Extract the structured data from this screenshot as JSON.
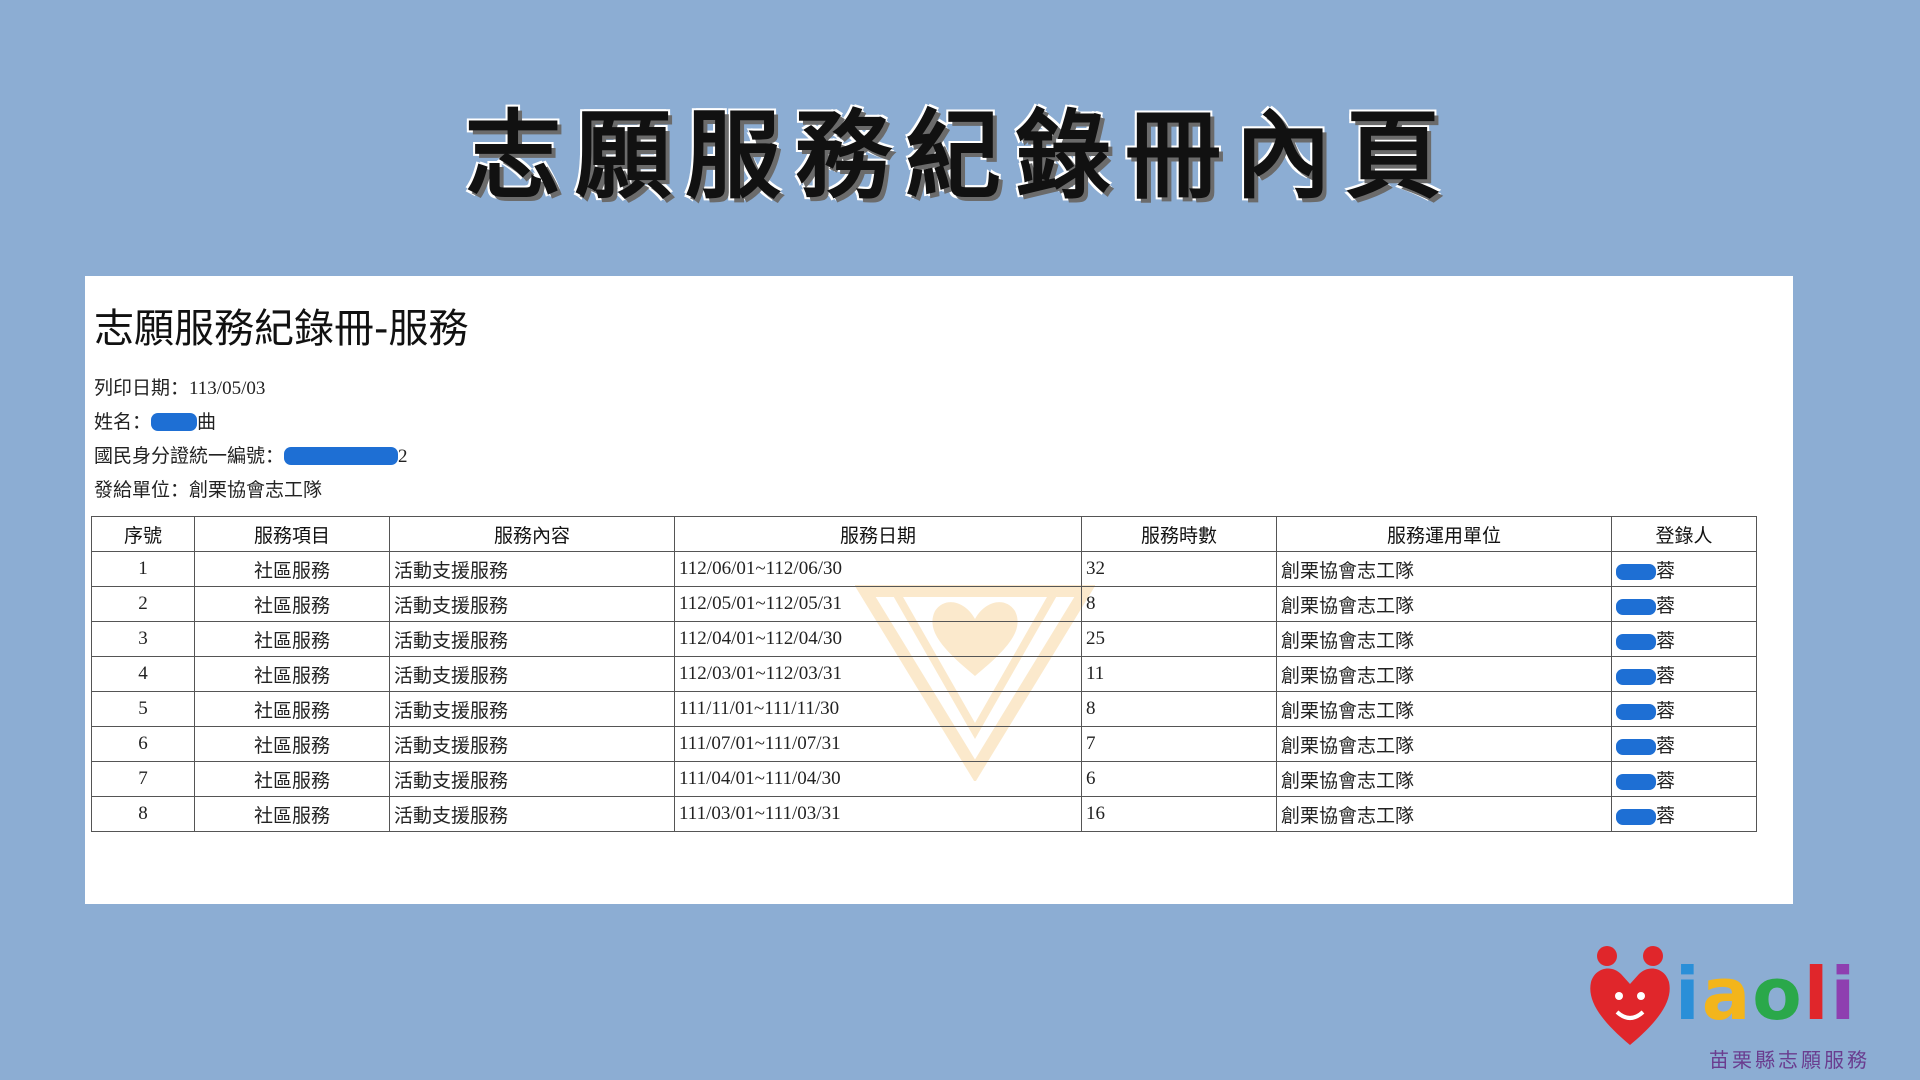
{
  "banner_title": "志願服務紀錄冊內頁",
  "document": {
    "title": "志願服務紀錄冊-服務",
    "print_date_label": "列印日期：",
    "print_date": "113/05/03",
    "name_label": "姓名：",
    "name_visible_suffix": "曲",
    "id_label": "國民身分證統一編號：",
    "id_visible_suffix": "2",
    "issuer_label": "發給單位：",
    "issuer": "創栗協會志工隊"
  },
  "table": {
    "headers": [
      "序號",
      "服務項目",
      "服務內容",
      "服務日期",
      "服務時數",
      "服務運用單位",
      "登錄人"
    ],
    "rows": [
      {
        "no": "1",
        "item": "社區服務",
        "content": "活動支援服務",
        "date": "112/06/01~112/06/30",
        "hours": "32",
        "unit": "創栗協會志工隊",
        "recorder_suffix": "蓉"
      },
      {
        "no": "2",
        "item": "社區服務",
        "content": "活動支援服務",
        "date": "112/05/01~112/05/31",
        "hours": "8",
        "unit": "創栗協會志工隊",
        "recorder_suffix": "蓉"
      },
      {
        "no": "3",
        "item": "社區服務",
        "content": "活動支援服務",
        "date": "112/04/01~112/04/30",
        "hours": "25",
        "unit": "創栗協會志工隊",
        "recorder_suffix": "蓉"
      },
      {
        "no": "4",
        "item": "社區服務",
        "content": "活動支援服務",
        "date": "112/03/01~112/03/31",
        "hours": "11",
        "unit": "創栗協會志工隊",
        "recorder_suffix": "蓉"
      },
      {
        "no": "5",
        "item": "社區服務",
        "content": "活動支援服務",
        "date": "111/11/01~111/11/30",
        "hours": "8",
        "unit": "創栗協會志工隊",
        "recorder_suffix": "蓉"
      },
      {
        "no": "6",
        "item": "社區服務",
        "content": "活動支援服務",
        "date": "111/07/01~111/07/31",
        "hours": "7",
        "unit": "創栗協會志工隊",
        "recorder_suffix": "蓉"
      },
      {
        "no": "7",
        "item": "社區服務",
        "content": "活動支援服務",
        "date": "111/04/01~111/04/30",
        "hours": "6",
        "unit": "創栗協會志工隊",
        "recorder_suffix": "蓉"
      },
      {
        "no": "8",
        "item": "社區服務",
        "content": "活動支援服務",
        "date": "111/03/01~111/03/31",
        "hours": "16",
        "unit": "創栗協會志工隊",
        "recorder_suffix": "蓉"
      }
    ]
  },
  "logo": {
    "text": "Miaoli",
    "subtitle": "苗栗縣志願服務",
    "colors": {
      "m": "#e0262b",
      "i": "#2a8fd8",
      "a": "#f3b51b",
      "o": "#2aa84a",
      "l": "#e0262b",
      "i2": "#8e3fb0"
    }
  },
  "colors": {
    "background": "#8cadd3",
    "redaction": "#1e6fd4",
    "watermark": "#f2b44a"
  }
}
